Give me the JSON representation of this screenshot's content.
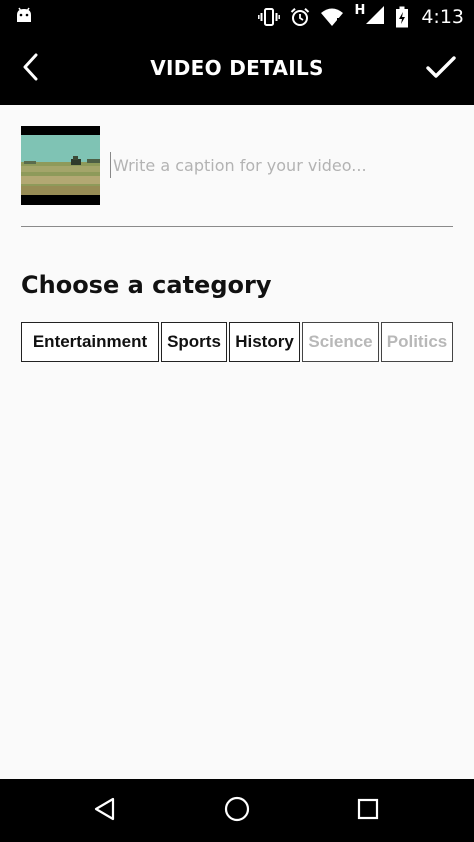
{
  "status_bar": {
    "time": "4:13",
    "network_label": "H",
    "icons": [
      "android-icon",
      "vibrate-icon",
      "alarm-icon",
      "wifi-icon",
      "cell-signal-icon",
      "battery-charging-icon"
    ]
  },
  "app_bar": {
    "title": "VIDEO DETAILS",
    "back_icon": "chevron-left-icon",
    "confirm_icon": "checkmark-icon"
  },
  "caption": {
    "value": "",
    "placeholder": "Write a caption for your video..."
  },
  "categories": {
    "title": "Choose a category",
    "items": [
      {
        "label": "Entertainment",
        "enabled": true
      },
      {
        "label": "Sports",
        "enabled": true
      },
      {
        "label": "History",
        "enabled": true
      },
      {
        "label": "Science",
        "enabled": false
      },
      {
        "label": "Politics",
        "enabled": false
      }
    ]
  },
  "nav_bar": {
    "icons": [
      "back-triangle-icon",
      "home-circle-icon",
      "recents-square-icon"
    ]
  },
  "colors": {
    "bar_background": "#000000",
    "content_background": "#fafafa",
    "disabled_text": "#b8b8b8"
  }
}
